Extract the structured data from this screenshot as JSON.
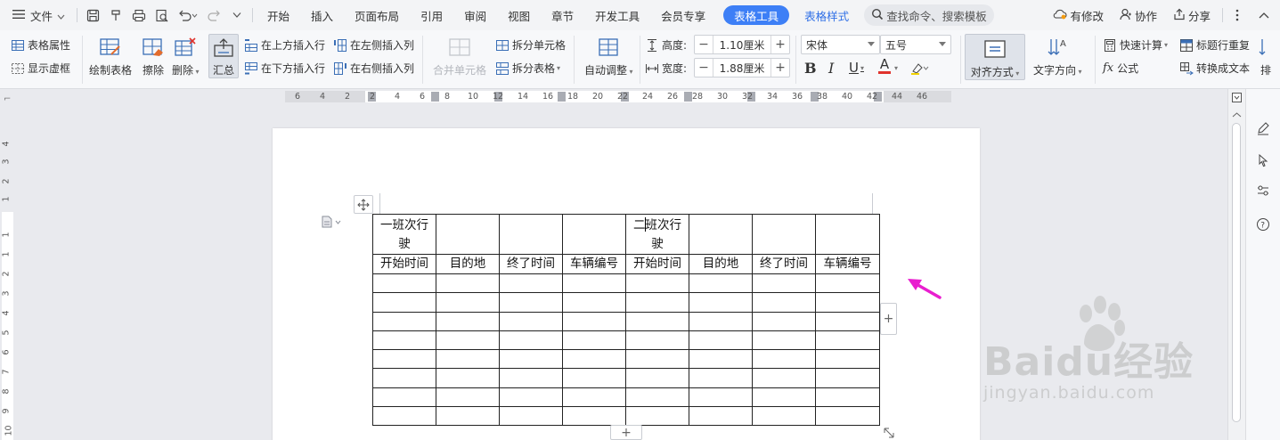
{
  "menubar": {
    "file_label": "文件",
    "tabs": [
      "开始",
      "插入",
      "页面布局",
      "引用",
      "审阅",
      "视图",
      "章节",
      "开发工具",
      "会员专享"
    ],
    "active_tab": "表格工具",
    "extra_tab": "表格样式",
    "search_placeholder": "查找命令、搜索模板",
    "status_changed": "有修改",
    "collab": "协作",
    "share": "分享"
  },
  "ribbon": {
    "table_props": "表格属性",
    "show_gridlines": "显示虚框",
    "draw_table": "绘制表格",
    "erase": "擦除",
    "delete": "删除",
    "summary": "汇总",
    "insert_above": "在上方插入行",
    "insert_below": "在下方插入行",
    "insert_left": "在左侧插入列",
    "insert_right": "在右侧插入列",
    "merge_cells": "合并单元格",
    "split_cells": "拆分单元格",
    "split_table": "拆分表格",
    "auto_fit": "自动调整",
    "height_label": "高度:",
    "height_value": "1.10厘米",
    "width_label": "宽度:",
    "width_value": "1.88厘米",
    "font_name": "宋体",
    "font_size": "五号",
    "align": "对齐方式",
    "text_direction": "文字方向",
    "quick_calc": "快速计算",
    "repeat_header": "标题行重复",
    "formula": "公式",
    "to_text": "转换成文本",
    "sort_partial": "排"
  },
  "hruler": {
    "ticks": [
      "6",
      "4",
      "2",
      "2",
      "4",
      "6",
      "8",
      "10",
      "12",
      "14",
      "16",
      "18",
      "20",
      "22",
      "24",
      "26",
      "28",
      "30",
      "32",
      "34",
      "36",
      "38",
      "40",
      "42",
      "44",
      "46"
    ]
  },
  "vruler": {
    "ticks": [
      "4",
      "3",
      "2",
      "1",
      "1",
      "1",
      "2",
      "3",
      "4",
      "5",
      "6",
      "7",
      "8",
      "9",
      "10",
      "11",
      "12"
    ]
  },
  "table": {
    "header_row1": [
      "一班次行驶",
      "",
      "",
      "",
      "二班次行驶",
      "",
      "",
      ""
    ],
    "header_row2": [
      "开始时间",
      "目的地",
      "终了时间",
      "车辆编号",
      "开始时间",
      "目的地",
      "终了时间",
      "车辆编号"
    ],
    "empty_rows": 8
  },
  "colors": {
    "accent": "#3d7ff6",
    "arrow": "#e91ecf"
  },
  "watermark": {
    "brand": "Baidu经验",
    "url": "jingyan.baidu.com"
  }
}
